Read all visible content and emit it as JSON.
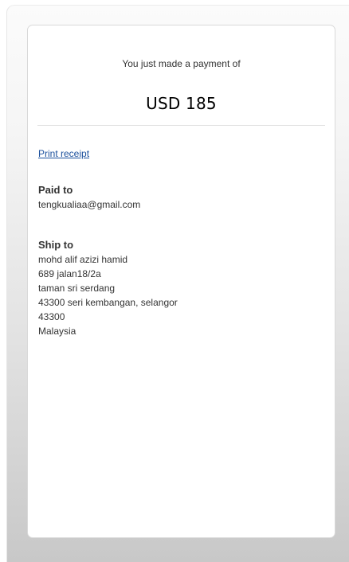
{
  "payment": {
    "label": "You just made a payment of",
    "amount": "USD 185"
  },
  "actions": {
    "print_receipt": "Print receipt"
  },
  "paid_to": {
    "heading": "Paid to",
    "email": "tengkualiaa@gmail.com"
  },
  "ship_to": {
    "heading": "Ship to",
    "lines": [
      "mohd alif azizi hamid",
      "689 jalan18/2a",
      "taman sri serdang",
      "43300 seri kembangan, selangor",
      "43300",
      "Malaysia"
    ]
  },
  "colors": {
    "link": "#1a4f9c",
    "text": "#333333",
    "amount": "#000000"
  }
}
